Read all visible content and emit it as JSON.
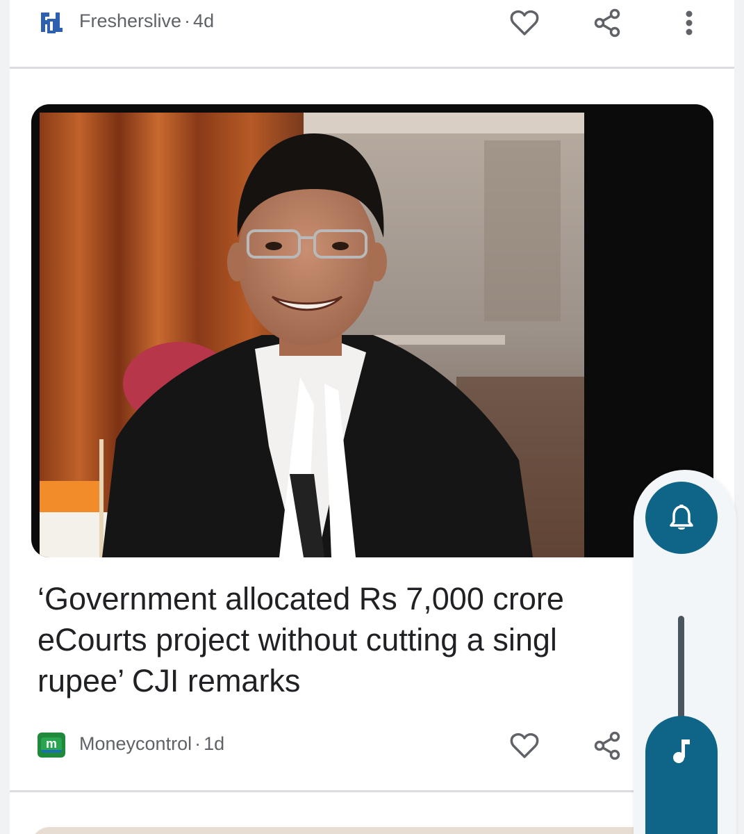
{
  "previous_article": {
    "source": {
      "name": "Fresherslive",
      "separator": "·",
      "age": "4d",
      "logo_icon": "fresherslive-logo"
    }
  },
  "article": {
    "image_alt": "Man in judge's robes smiling",
    "headline": "‘Government allocated Rs 7,000 crore\neCourts project without cutting a singl\nrupee’ CJI remarks",
    "source": {
      "name": "Moneycontrol",
      "separator": "·",
      "age": "1d",
      "logo_icon": "moneycontrol-logo",
      "logo_letter": "m"
    }
  },
  "actions": {
    "like_icon": "heart-outline-icon",
    "share_icon": "share-icon",
    "more_icon": "more-vert-icon"
  },
  "side_panel": {
    "bell_icon": "bell-icon",
    "music_icon": "music-note-icon"
  },
  "colors": {
    "accent": "#0f6587",
    "source_text": "#5f6368",
    "headline_text": "#202124",
    "fresherslive_blue": "#2f5fb0",
    "moneycontrol_green": "#1f8a3b"
  }
}
